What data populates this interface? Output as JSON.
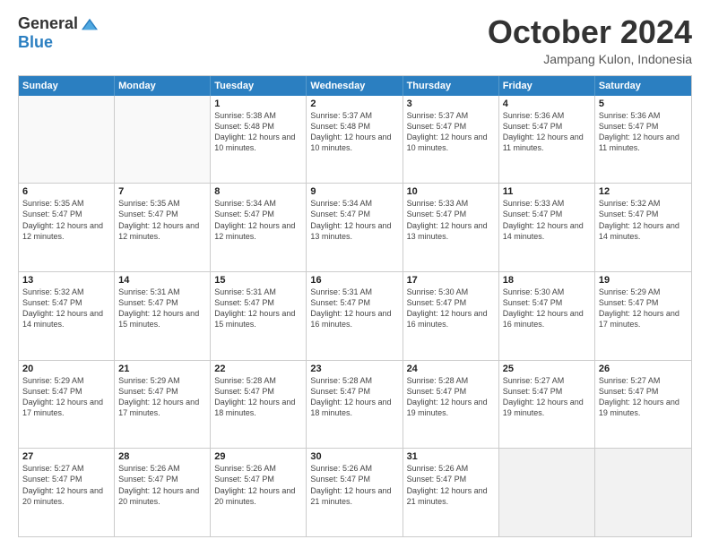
{
  "logo": {
    "general": "General",
    "blue": "Blue"
  },
  "header": {
    "month": "October 2024",
    "location": "Jampang Kulon, Indonesia"
  },
  "days": [
    "Sunday",
    "Monday",
    "Tuesday",
    "Wednesday",
    "Thursday",
    "Friday",
    "Saturday"
  ],
  "weeks": [
    [
      {
        "day": "",
        "empty": true
      },
      {
        "day": "",
        "empty": true
      },
      {
        "day": "1",
        "sunrise": "Sunrise: 5:38 AM",
        "sunset": "Sunset: 5:48 PM",
        "daylight": "Daylight: 12 hours and 10 minutes."
      },
      {
        "day": "2",
        "sunrise": "Sunrise: 5:37 AM",
        "sunset": "Sunset: 5:48 PM",
        "daylight": "Daylight: 12 hours and 10 minutes."
      },
      {
        "day": "3",
        "sunrise": "Sunrise: 5:37 AM",
        "sunset": "Sunset: 5:47 PM",
        "daylight": "Daylight: 12 hours and 10 minutes."
      },
      {
        "day": "4",
        "sunrise": "Sunrise: 5:36 AM",
        "sunset": "Sunset: 5:47 PM",
        "daylight": "Daylight: 12 hours and 11 minutes."
      },
      {
        "day": "5",
        "sunrise": "Sunrise: 5:36 AM",
        "sunset": "Sunset: 5:47 PM",
        "daylight": "Daylight: 12 hours and 11 minutes."
      }
    ],
    [
      {
        "day": "6",
        "sunrise": "Sunrise: 5:35 AM",
        "sunset": "Sunset: 5:47 PM",
        "daylight": "Daylight: 12 hours and 12 minutes."
      },
      {
        "day": "7",
        "sunrise": "Sunrise: 5:35 AM",
        "sunset": "Sunset: 5:47 PM",
        "daylight": "Daylight: 12 hours and 12 minutes."
      },
      {
        "day": "8",
        "sunrise": "Sunrise: 5:34 AM",
        "sunset": "Sunset: 5:47 PM",
        "daylight": "Daylight: 12 hours and 12 minutes."
      },
      {
        "day": "9",
        "sunrise": "Sunrise: 5:34 AM",
        "sunset": "Sunset: 5:47 PM",
        "daylight": "Daylight: 12 hours and 13 minutes."
      },
      {
        "day": "10",
        "sunrise": "Sunrise: 5:33 AM",
        "sunset": "Sunset: 5:47 PM",
        "daylight": "Daylight: 12 hours and 13 minutes."
      },
      {
        "day": "11",
        "sunrise": "Sunrise: 5:33 AM",
        "sunset": "Sunset: 5:47 PM",
        "daylight": "Daylight: 12 hours and 14 minutes."
      },
      {
        "day": "12",
        "sunrise": "Sunrise: 5:32 AM",
        "sunset": "Sunset: 5:47 PM",
        "daylight": "Daylight: 12 hours and 14 minutes."
      }
    ],
    [
      {
        "day": "13",
        "sunrise": "Sunrise: 5:32 AM",
        "sunset": "Sunset: 5:47 PM",
        "daylight": "Daylight: 12 hours and 14 minutes."
      },
      {
        "day": "14",
        "sunrise": "Sunrise: 5:31 AM",
        "sunset": "Sunset: 5:47 PM",
        "daylight": "Daylight: 12 hours and 15 minutes."
      },
      {
        "day": "15",
        "sunrise": "Sunrise: 5:31 AM",
        "sunset": "Sunset: 5:47 PM",
        "daylight": "Daylight: 12 hours and 15 minutes."
      },
      {
        "day": "16",
        "sunrise": "Sunrise: 5:31 AM",
        "sunset": "Sunset: 5:47 PM",
        "daylight": "Daylight: 12 hours and 16 minutes."
      },
      {
        "day": "17",
        "sunrise": "Sunrise: 5:30 AM",
        "sunset": "Sunset: 5:47 PM",
        "daylight": "Daylight: 12 hours and 16 minutes."
      },
      {
        "day": "18",
        "sunrise": "Sunrise: 5:30 AM",
        "sunset": "Sunset: 5:47 PM",
        "daylight": "Daylight: 12 hours and 16 minutes."
      },
      {
        "day": "19",
        "sunrise": "Sunrise: 5:29 AM",
        "sunset": "Sunset: 5:47 PM",
        "daylight": "Daylight: 12 hours and 17 minutes."
      }
    ],
    [
      {
        "day": "20",
        "sunrise": "Sunrise: 5:29 AM",
        "sunset": "Sunset: 5:47 PM",
        "daylight": "Daylight: 12 hours and 17 minutes."
      },
      {
        "day": "21",
        "sunrise": "Sunrise: 5:29 AM",
        "sunset": "Sunset: 5:47 PM",
        "daylight": "Daylight: 12 hours and 17 minutes."
      },
      {
        "day": "22",
        "sunrise": "Sunrise: 5:28 AM",
        "sunset": "Sunset: 5:47 PM",
        "daylight": "Daylight: 12 hours and 18 minutes."
      },
      {
        "day": "23",
        "sunrise": "Sunrise: 5:28 AM",
        "sunset": "Sunset: 5:47 PM",
        "daylight": "Daylight: 12 hours and 18 minutes."
      },
      {
        "day": "24",
        "sunrise": "Sunrise: 5:28 AM",
        "sunset": "Sunset: 5:47 PM",
        "daylight": "Daylight: 12 hours and 19 minutes."
      },
      {
        "day": "25",
        "sunrise": "Sunrise: 5:27 AM",
        "sunset": "Sunset: 5:47 PM",
        "daylight": "Daylight: 12 hours and 19 minutes."
      },
      {
        "day": "26",
        "sunrise": "Sunrise: 5:27 AM",
        "sunset": "Sunset: 5:47 PM",
        "daylight": "Daylight: 12 hours and 19 minutes."
      }
    ],
    [
      {
        "day": "27",
        "sunrise": "Sunrise: 5:27 AM",
        "sunset": "Sunset: 5:47 PM",
        "daylight": "Daylight: 12 hours and 20 minutes."
      },
      {
        "day": "28",
        "sunrise": "Sunrise: 5:26 AM",
        "sunset": "Sunset: 5:47 PM",
        "daylight": "Daylight: 12 hours and 20 minutes."
      },
      {
        "day": "29",
        "sunrise": "Sunrise: 5:26 AM",
        "sunset": "Sunset: 5:47 PM",
        "daylight": "Daylight: 12 hours and 20 minutes."
      },
      {
        "day": "30",
        "sunrise": "Sunrise: 5:26 AM",
        "sunset": "Sunset: 5:47 PM",
        "daylight": "Daylight: 12 hours and 21 minutes."
      },
      {
        "day": "31",
        "sunrise": "Sunrise: 5:26 AM",
        "sunset": "Sunset: 5:47 PM",
        "daylight": "Daylight: 12 hours and 21 minutes."
      },
      {
        "day": "",
        "empty": true
      },
      {
        "day": "",
        "empty": true
      }
    ]
  ]
}
